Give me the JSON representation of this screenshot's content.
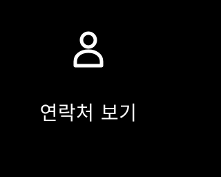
{
  "tile": {
    "label": "연락처 보기",
    "icon": "person-icon"
  },
  "colors": {
    "background": "#000000",
    "foreground": "#ffffff"
  }
}
